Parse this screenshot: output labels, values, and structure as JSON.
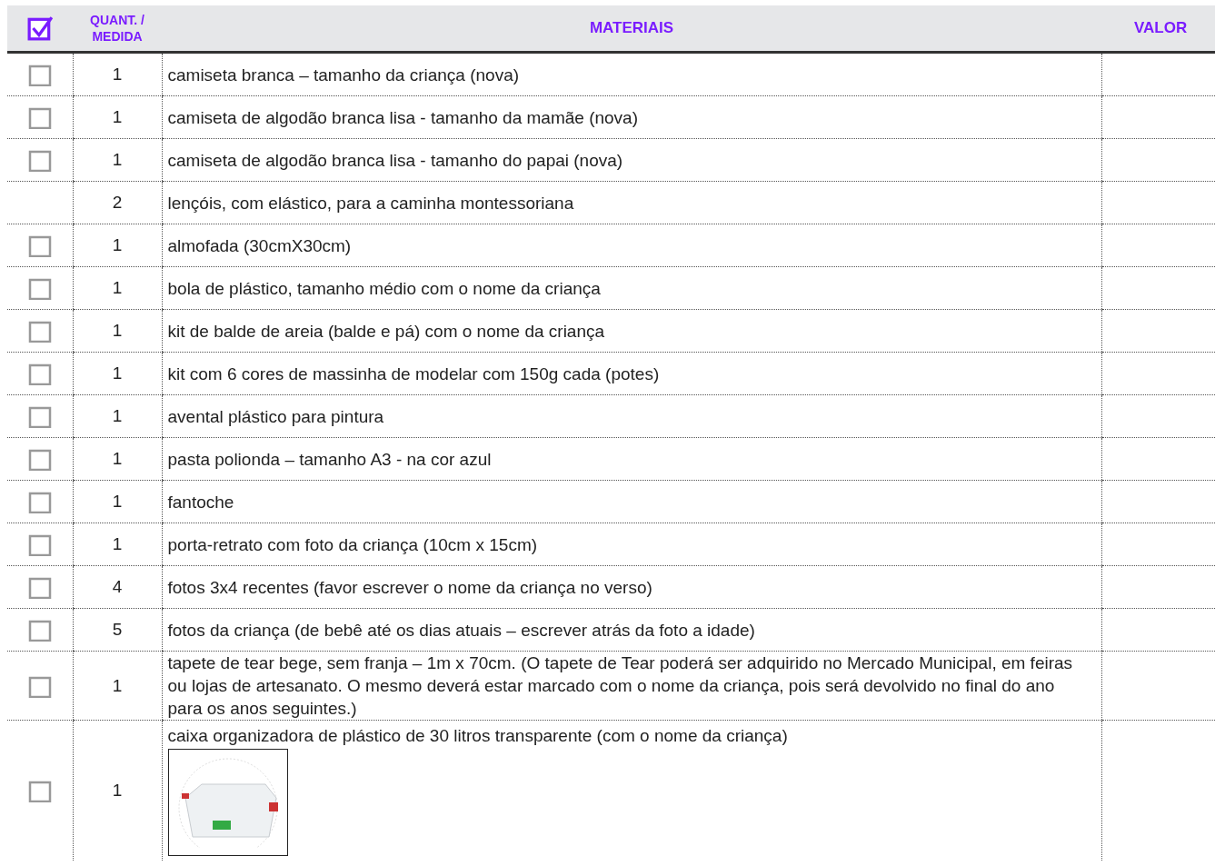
{
  "table": {
    "header_checkbox": {
      "checked": true
    },
    "columns": [
      "QUANT. / MEDIDA",
      "MATERIAIS",
      "VALOR"
    ],
    "rows": [
      {
        "kind": "checkbox",
        "checked": false,
        "quantity": "1",
        "material": "camiseta branca – tamanho da criança (nova)"
      },
      {
        "kind": "checkbox",
        "checked": false,
        "quantity": "1",
        "material": "camiseta de algodão branca lisa - tamanho da mamãe (nova)"
      },
      {
        "kind": "checkbox",
        "checked": false,
        "quantity": "1",
        "material": "camiseta de algodão branca lisa - tamanho do papai (nova)"
      },
      {
        "kind": "plain",
        "quantity": "2",
        "material": "lençóis, com elástico, para a caminha montessoriana"
      },
      {
        "kind": "checkbox",
        "checked": false,
        "quantity": "1",
        "material": "almofada (30cmX30cm)"
      },
      {
        "kind": "checkbox",
        "checked": false,
        "quantity": "1",
        "material": "bola de plástico, tamanho médio com o nome da criança"
      },
      {
        "kind": "checkbox",
        "checked": false,
        "quantity": "1",
        "material": "kit de balde de areia (balde e pá) com o nome da criança"
      },
      {
        "kind": "checkbox",
        "checked": false,
        "quantity": "1",
        "material": "kit com 6 cores de massinha de modelar com 150g cada (potes)"
      },
      {
        "kind": "checkbox",
        "checked": false,
        "quantity": "1",
        "material": "avental plástico para pintura"
      },
      {
        "kind": "checkbox",
        "checked": false,
        "quantity": "1",
        "material": "pasta polionda – tamanho A3 - na cor azul"
      },
      {
        "kind": "checkbox",
        "checked": false,
        "quantity": "1",
        "material": "fantoche"
      },
      {
        "kind": "checkbox",
        "checked": false,
        "quantity": "1",
        "material": "porta-retrato com foto da criança (10cm x 15cm)"
      },
      {
        "kind": "checkbox",
        "checked": false,
        "quantity": "4",
        "material": "fotos 3x4 recentes (favor escrever o nome da criança no verso)"
      },
      {
        "kind": "checkbox",
        "checked": false,
        "quantity": "5",
        "material": "fotos da criança (de bebê até os dias atuais – escrever atrás da foto a idade)"
      },
      {
        "kind": "checkbox",
        "checked": false,
        "quantity": "1",
        "material": "tapete de tear bege, sem franja – 1m x 70cm. (O tapete de Tear poderá ser adquirido no Mercado Municipal, em feiras ou lojas de artesanato. O mesmo deverá estar marcado com o nome da criança, pois será devolvido no final do ano para os anos seguintes.)"
      },
      {
        "kind": "checkbox_photo",
        "checked": false,
        "quantity": "1",
        "material": "caixa organizadora de plástico de 30 litros transparente (com o nome da criança)"
      }
    ]
  }
}
